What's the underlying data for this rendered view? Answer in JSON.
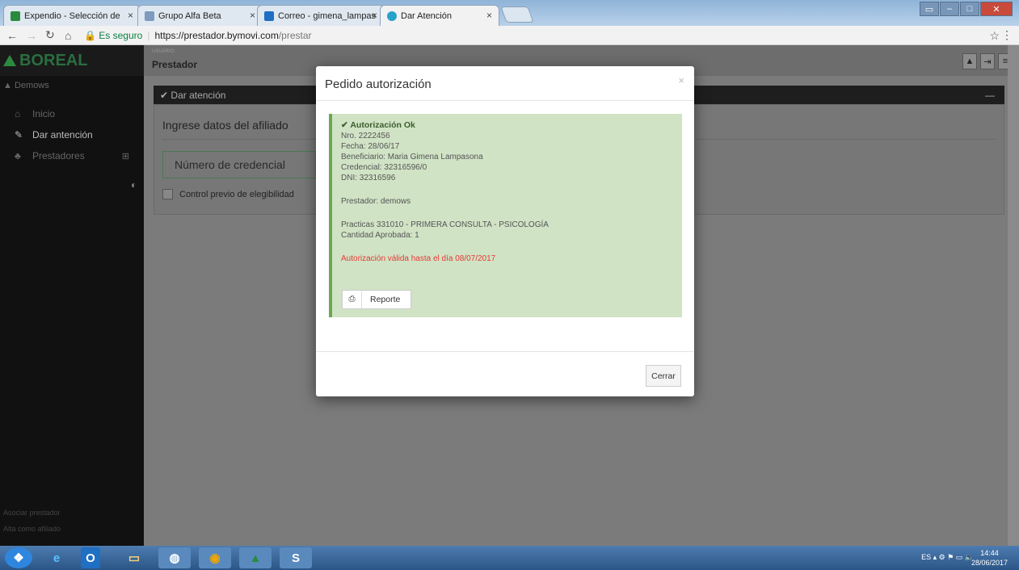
{
  "browser": {
    "tabs": [
      {
        "label": "Expendio - Selección de"
      },
      {
        "label": "Grupo Alfa Beta"
      },
      {
        "label": "Correo - gimena_lampas"
      },
      {
        "label": "Dar Atención"
      }
    ],
    "secure_label": "Es seguro",
    "url_host": "https://prestador.bymovi.com",
    "url_path": "/prestar"
  },
  "sidebar": {
    "logo": "BOREAL",
    "user": "Demows",
    "items": [
      {
        "label": "Inicio",
        "icon": "home-icon"
      },
      {
        "label": "Dar antención",
        "icon": "edit-icon"
      },
      {
        "label": "Prestadores",
        "icon": "users-icon"
      }
    ],
    "footer": [
      "Asociar prestador",
      "Alta como afiliado"
    ]
  },
  "header": {
    "user_label": "USUARIO:",
    "user_value": "Prestador"
  },
  "panel": {
    "heading": "Dar atención",
    "title": "Ingrese datos del afiliado",
    "credential_placeholder": "Número de credencial",
    "checkbox_label": "Control previo de elegibilidad"
  },
  "modal": {
    "title": "Pedido autorización",
    "close": "×",
    "status": "Autorización Ok",
    "lines": [
      "Nro. 2222456",
      "Fecha: 28/06/17",
      "Beneficiario: Maria Gimena Lampasona",
      "Credencial: 32316596/0",
      "DNI: 32316596"
    ],
    "prestador": "Prestador: demows",
    "practicas": "Practicas 331010 - PRIMERA CONSULTA - PSICOLOGÍA",
    "cantidad": "Cantidad Aprobada: 1",
    "validity": "Autorización válida hasta el día 08/07/2017",
    "report_button": "Reporte",
    "close_button": "Cerrar"
  },
  "taskbar": {
    "lang": "ES",
    "time": "14:44",
    "date": "28/06/2017"
  },
  "colors": {
    "accent_green": "#6aa84f",
    "alert_bg": "#d0e3c5",
    "red_text": "#e53935"
  }
}
